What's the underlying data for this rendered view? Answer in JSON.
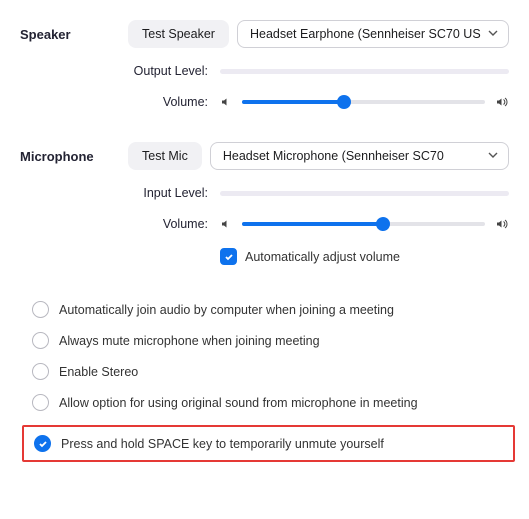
{
  "speaker": {
    "section_label": "Speaker",
    "test_button": "Test Speaker",
    "device": "Headset Earphone (Sennheiser SC70 US",
    "output_level_label": "Output Level:",
    "volume_label": "Volume:",
    "volume_percent": 42
  },
  "microphone": {
    "section_label": "Microphone",
    "test_button": "Test Mic",
    "device": "Headset Microphone (Sennheiser SC70",
    "input_level_label": "Input Level:",
    "volume_label": "Volume:",
    "volume_percent": 58,
    "auto_adjust_label": "Automatically adjust volume",
    "auto_adjust_checked": true
  },
  "options": {
    "auto_join": {
      "label": "Automatically join audio by computer when joining a meeting",
      "checked": false
    },
    "always_mute": {
      "label": "Always mute microphone when joining meeting",
      "checked": false
    },
    "enable_stereo": {
      "label": "Enable Stereo",
      "checked": false
    },
    "original_sound": {
      "label": "Allow option for using original sound from microphone in meeting",
      "checked": false
    },
    "space_unmute": {
      "label": "Press and hold SPACE key to temporarily unmute yourself",
      "checked": true
    }
  }
}
